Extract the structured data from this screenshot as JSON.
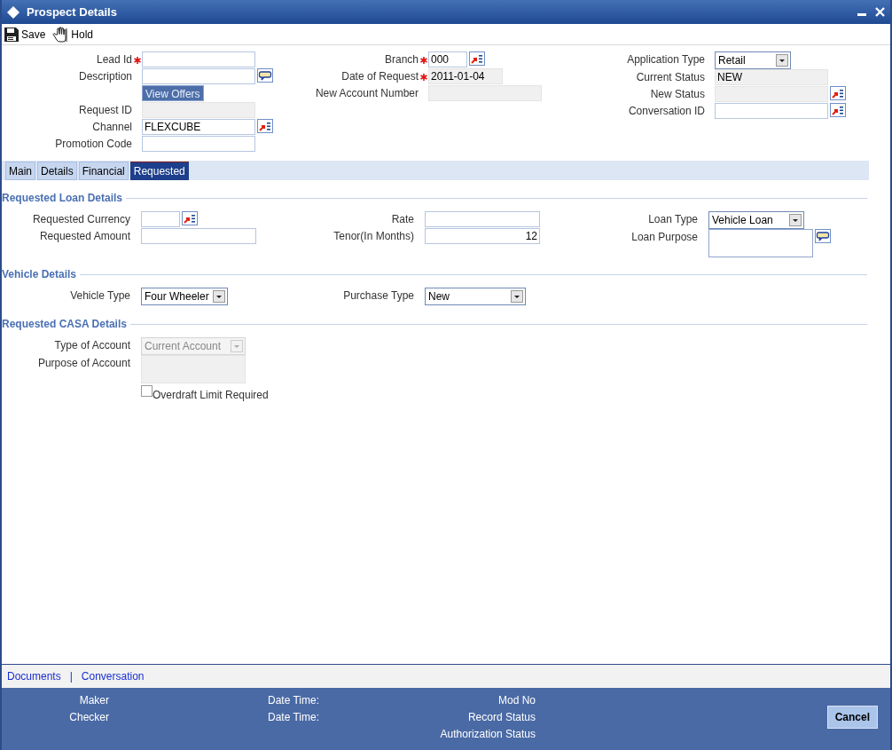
{
  "window": {
    "title": "Prospect Details"
  },
  "toolbar": [
    {
      "kind": "save",
      "label": "Save"
    },
    {
      "kind": "hold",
      "label": "Hold"
    }
  ],
  "header": {
    "columns": [
      [
        {
          "label": "Lead Id",
          "required": true,
          "kind": "text"
        },
        {
          "label": "Description",
          "required": false,
          "kind": "memo"
        },
        {
          "label": "View Offers",
          "required": false,
          "kind": "button"
        },
        {
          "label": "Request ID",
          "required": false,
          "kind": "readonly"
        },
        {
          "label": "Channel",
          "required": false,
          "kind": "lov",
          "value": "FLEXCUBE"
        },
        {
          "label": "Promotion Code",
          "required": false,
          "kind": "text"
        }
      ],
      [
        {
          "label": "Branch",
          "required": true,
          "kind": "lov",
          "value": "000"
        },
        {
          "label": "Date of Request",
          "required": true,
          "kind": "readonly",
          "value": "2011-01-04"
        },
        {
          "label": "New Account Number",
          "required": false,
          "kind": "readonly"
        }
      ],
      [
        {
          "label": "Application Type",
          "required": false,
          "kind": "select",
          "value": "Retail"
        },
        {
          "label": "Current Status",
          "required": false,
          "kind": "readonly",
          "value": "NEW"
        },
        {
          "label": "New Status",
          "required": false,
          "kind": "readonly-lov"
        },
        {
          "label": "Conversation ID",
          "required": false,
          "kind": "lov"
        }
      ]
    ]
  },
  "tabs": [
    {
      "label": "Main",
      "selected": false
    },
    {
      "label": "Details",
      "selected": false
    },
    {
      "label": "Financial",
      "selected": false
    },
    {
      "label": "Requested",
      "selected": true
    }
  ],
  "sections": [
    {
      "title": "Requested Loan Details",
      "columns": [
        [
          {
            "label": "Requested Currency",
            "kind": "lov"
          },
          {
            "label": "Requested Amount",
            "kind": "text"
          }
        ],
        [
          {
            "label": "Rate",
            "kind": "text"
          },
          {
            "label": "Tenor(In Months)",
            "kind": "number",
            "value": "12"
          }
        ],
        [
          {
            "label": "Loan Type",
            "kind": "select",
            "value": "Vehicle Loan"
          },
          {
            "label": "Loan Purpose",
            "kind": "textarea-memo"
          }
        ]
      ]
    },
    {
      "title": "Vehicle Details",
      "columns": [
        [
          {
            "label": "Vehicle Type",
            "kind": "select",
            "value": "Four Wheeler"
          }
        ],
        [
          {
            "label": "Purchase Type",
            "kind": "select",
            "value": "New"
          }
        ]
      ]
    },
    {
      "title": "Requested CASA Details",
      "columns": [
        [
          {
            "label": "Type of Account",
            "kind": "select-disabled",
            "value": "Current Account"
          },
          {
            "label": "Purpose of Account",
            "kind": "textarea-readonly"
          },
          {
            "label": "Overdraft Limit Required",
            "kind": "checkbox",
            "checked": false
          }
        ]
      ]
    }
  ],
  "footer": {
    "links": [
      "Documents",
      "Conversation"
    ],
    "separator": "|"
  },
  "audit": {
    "columns": [
      [
        "Maker",
        "Checker"
      ],
      [
        "Date Time:",
        "Date Time:"
      ],
      [
        "Mod No",
        "Record Status",
        "Authorization Status"
      ]
    ],
    "cancel": "Cancel"
  }
}
